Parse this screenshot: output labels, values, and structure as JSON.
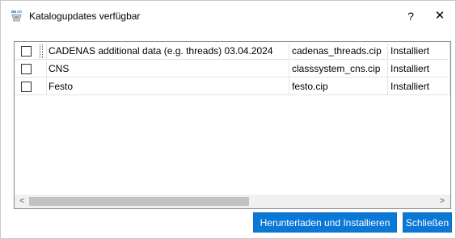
{
  "window": {
    "title": "Katalogupdates verfügbar",
    "help_label": "?",
    "close_label": "✕"
  },
  "list": {
    "rows": [
      {
        "checked": false,
        "name": "CADENAS additional data (e.g. threads) 03.04.2024",
        "file": "cadenas_threads.cip",
        "status": "Installiert"
      },
      {
        "checked": false,
        "name": "CNS",
        "file": "classsystem_cns.cip",
        "status": "Installiert"
      },
      {
        "checked": false,
        "name": "Festo",
        "file": "festo.cip",
        "status": "Installiert"
      }
    ],
    "scroll_left_label": "<",
    "scroll_right_label": ">",
    "scroll_position": 0
  },
  "buttons": {
    "install_label": "Herunterladen und Installieren",
    "close_label": "Schließen"
  },
  "colors": {
    "accent": "#0a78d7"
  }
}
